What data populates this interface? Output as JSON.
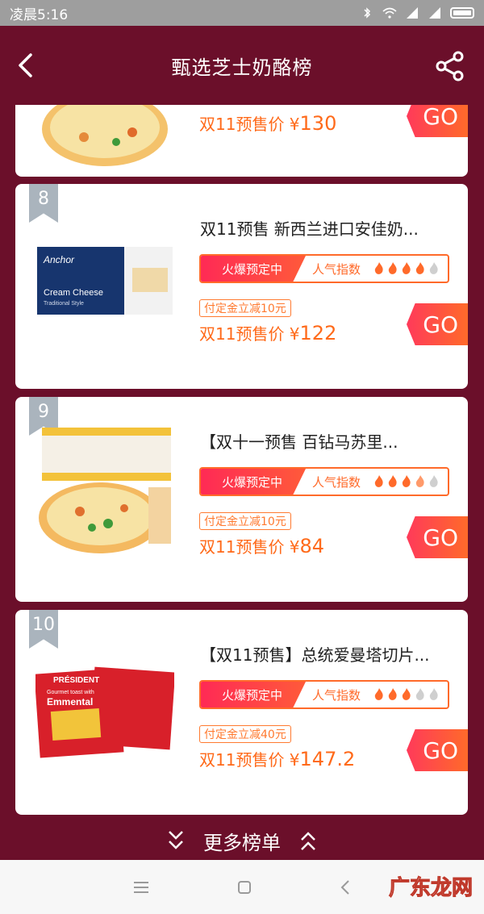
{
  "status_bar": {
    "time": "凌晨5:16"
  },
  "header": {
    "title": "甄选芝士奶酪榜"
  },
  "cards": [
    {
      "rank": "",
      "title": "",
      "heat_tag": "",
      "heat_label": "",
      "heat_level": null,
      "coupon": "",
      "price_label": "双11预售价 ¥",
      "price": "130",
      "go": "GO"
    },
    {
      "rank": "8",
      "title": "双11预售 新西兰进口安佳奶...",
      "heat_tag": "火爆预定中",
      "heat_label": "人气指数",
      "heat_level": 4,
      "coupon": "付定金立减10元",
      "price_label": "双11预售价 ¥",
      "price": "122",
      "go": "GO"
    },
    {
      "rank": "9",
      "title": "【双十一预售 百钻马苏里...",
      "heat_tag": "火爆预定中",
      "heat_label": "人气指数",
      "heat_level": 3,
      "coupon": "付定金立减10元",
      "price_label": "双11预售价 ¥",
      "price": "84",
      "go": "GO"
    },
    {
      "rank": "10",
      "title": "【双11预售】总统爱曼塔切片...",
      "heat_tag": "火爆预定中",
      "heat_label": "人气指数",
      "heat_level": 3,
      "coupon": "付定金立减40元",
      "price_label": "双11预售价 ¥",
      "price": "147.2",
      "go": "GO"
    }
  ],
  "images": {
    "anchor_brand": "Anchor",
    "anchor_product": "Cream Cheese",
    "anchor_sub": "Traditional Style",
    "president_brand": "PRÉSIDENT",
    "president_product": "Emmental",
    "president_sub": "Gourmet toast with"
  },
  "more": {
    "label": "更多榜单"
  },
  "watermark": "广东龙网",
  "colors": {
    "bg": "#6b0f2a",
    "accent": "#ff6a2a",
    "go_start": "#ff3a5a"
  }
}
